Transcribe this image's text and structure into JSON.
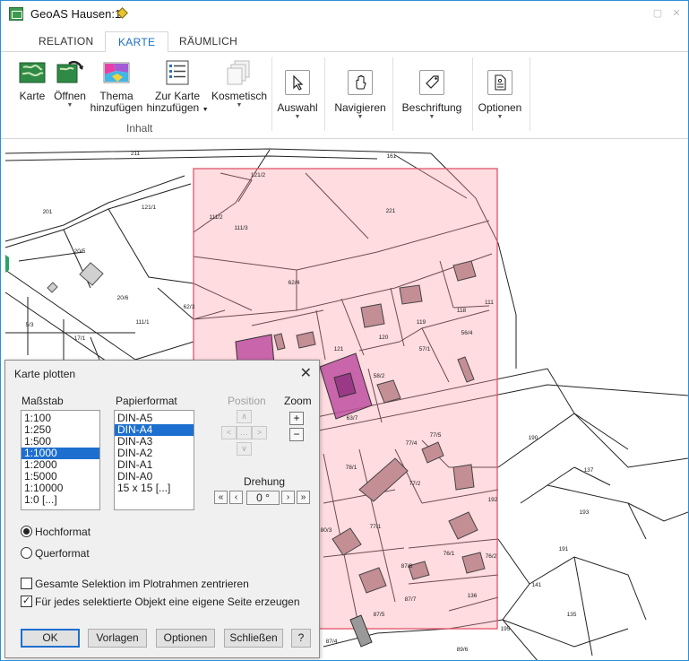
{
  "window": {
    "title": "GeoAS Hausen:1"
  },
  "tabs": [
    {
      "label": "RELATION"
    },
    {
      "label": "KARTE"
    },
    {
      "label": "RÄUMLICH"
    }
  ],
  "ribbon": {
    "karte": "Karte",
    "oeffnen": "Öffnen",
    "thema_1": "Thema",
    "thema_2": "hinzufügen",
    "zurkarte_1": "Zur Karte",
    "zurkarte_2": "hinzufügen",
    "kosmetisch": "Kosmetisch",
    "group_inhalt": "Inhalt",
    "auswahl": "Auswahl",
    "navigieren": "Navigieren",
    "beschriftung": "Beschriftung",
    "optionen": "Optionen"
  },
  "map_labels": {
    "l211": "211",
    "l161": "161",
    "l121_2": "121/2",
    "l121_1": "121/1",
    "l201": "201",
    "l111_2": "111/2",
    "l111_3": "111/3",
    "l221": "221",
    "l20_5": "20/5",
    "l62_4": "62/4",
    "l20_6": "20/6",
    "l62_3": "62/3",
    "l111_1": "111/1",
    "l119": "119",
    "l118": "118",
    "l111": "111",
    "l5_3": "5/3",
    "l17_1": "17/1",
    "l121": "121",
    "l120": "120",
    "l57_1": "57/1",
    "l56_4": "56/4",
    "l58_2": "58/2",
    "l63_7": "63/7",
    "l190": "190",
    "l77_4": "77/4",
    "l77_5": "77/5",
    "l78_1": "78/1",
    "l137": "137",
    "l77_2": "77/2",
    "l192": "192",
    "l193": "193",
    "l80_3": "80/3",
    "l77_1": "77/1",
    "l191": "191",
    "l76_1": "76/1",
    "l87_8": "87/8",
    "l76_2": "76/2",
    "l141": "141",
    "l87_7": "87/7",
    "l136": "136",
    "l87_5": "87/5",
    "l135": "135",
    "l195": "195",
    "l87_4": "87/4",
    "l89_6": "89/6"
  },
  "dialog": {
    "title": "Karte plotten",
    "massstab_label": "Maßstab",
    "massstab_items": [
      "1:100",
      "1:250",
      "1:500",
      "1:1000",
      "1:2000",
      "1:5000",
      "1:10000",
      "1:0 [...]"
    ],
    "papierformat_label": "Papierformat",
    "papier_items": [
      "DIN-A5",
      "DIN-A4",
      "DIN-A3",
      "DIN-A2",
      "DIN-A1",
      "DIN-A0",
      "15 x 15 [...]"
    ],
    "position_label": "Position",
    "zoom_label": "Zoom",
    "zoom_in": "+",
    "zoom_out": "−",
    "drehung_label": "Drehung",
    "drehung_value": "0 °",
    "hochformat": "Hochformat",
    "querformat": "Querformat",
    "chk_zentrieren": "Gesamte Selektion im Plotrahmen zentrieren",
    "chk_eigene_seite": "Für jedes selektierte Objekt eine eigene Seite erzeugen",
    "btn_ok": "OK",
    "btn_vorlagen": "Vorlagen",
    "btn_optionen": "Optionen",
    "btn_schliessen": "Schließen",
    "btn_help": "?"
  }
}
